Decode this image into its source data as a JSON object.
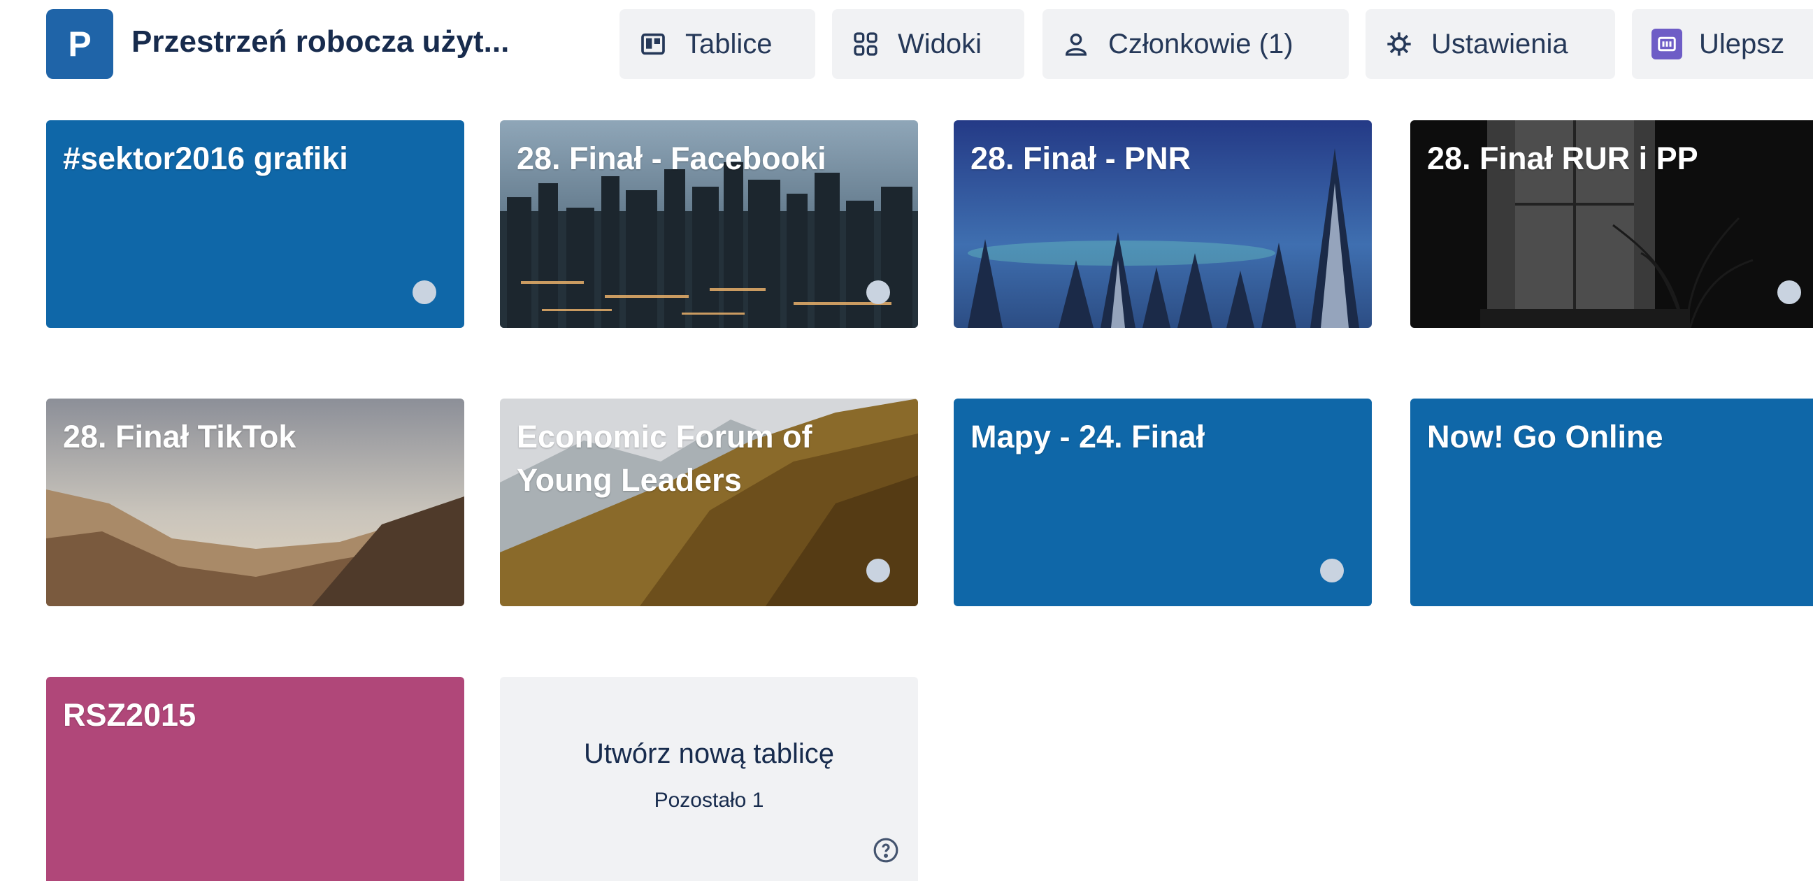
{
  "workspace": {
    "avatar_letter": "P",
    "title": "Przestrzeń robocza użyt..."
  },
  "header_buttons": [
    {
      "label": "Tablice",
      "icon": "board-icon"
    },
    {
      "label": "Widoki",
      "icon": "grid-icon"
    },
    {
      "label": "Członkowie (1)",
      "icon": "person-icon"
    },
    {
      "label": "Ustawienia",
      "icon": "gear-icon"
    },
    {
      "label": "Ulepsz",
      "icon": "upgrade-icon"
    }
  ],
  "boards": [
    {
      "title": "#sektor2016 grafiki",
      "background": "#0f67a8",
      "starred_dot": true
    },
    {
      "title": "28. Finał - Facebooki",
      "background": "city-photo",
      "starred_dot": true
    },
    {
      "title": "28. Finał - PNR",
      "background": "winter-forest-photo",
      "starred_dot": false
    },
    {
      "title": "28. Finał RUR i PP",
      "background": "dark-window-photo",
      "starred_dot": true
    },
    {
      "title": "28. Finał TikTok",
      "background": "mountain-photo",
      "starred_dot": false
    },
    {
      "title": "Economic Forum of Young Leaders",
      "background": "autumn-forest-photo",
      "starred_dot": true
    },
    {
      "title": "Mapy - 24. Finał",
      "background": "#0f67a8",
      "starred_dot": true
    },
    {
      "title": "Now! Go Online",
      "background": "#0f67a8",
      "starred_dot": false
    },
    {
      "title": "RSZ2015",
      "background": "#b04779",
      "starred_dot": false
    }
  ],
  "create_board": {
    "label": "Utwórz nową tablicę",
    "remaining": "Pozostało 1",
    "help_icon": "help-icon"
  },
  "colors": {
    "brand_blue": "#0f67a8",
    "pink": "#b04779",
    "upgrade_purple": "#6e5dc6",
    "button_bg": "#f1f2f4"
  }
}
